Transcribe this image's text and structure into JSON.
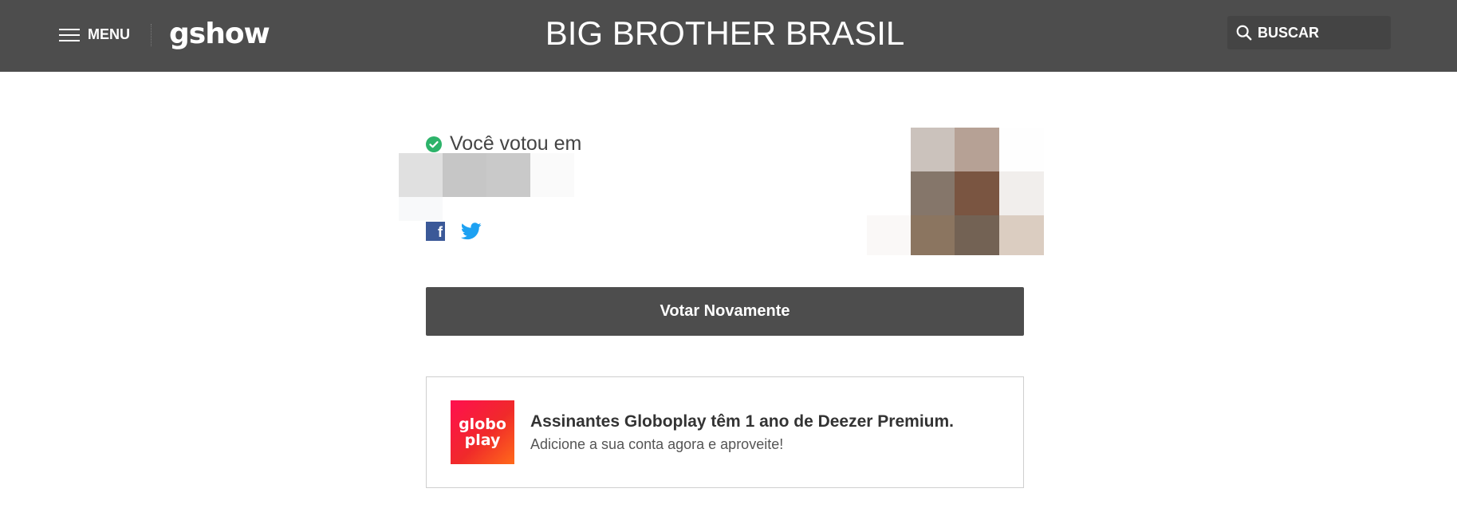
{
  "header": {
    "menu_label": "MENU",
    "logo_text": "gshow",
    "title": "BIG BROTHER BRASIL",
    "search_label": "BUSCAR"
  },
  "vote": {
    "voted_text": "Você votou em",
    "share": {
      "facebook_icon": "facebook-icon",
      "twitter_icon": "twitter-icon"
    },
    "vote_again_label": "Votar Novamente"
  },
  "promo": {
    "logo_line1": "globo",
    "logo_line2": "play",
    "title": "Assinantes Globoplay têm 1 ano de Deezer Premium.",
    "subtitle": "Adicione a sua conta agora e aproveite!"
  },
  "colors": {
    "header_bg": "#4d4d4d",
    "check_green": "#2db36a",
    "facebook_blue": "#3b5998",
    "twitter_blue": "#1da1f2",
    "globoplay_gradient_start": "#ff0f4f",
    "globoplay_gradient_end": "#ff6a1a"
  }
}
